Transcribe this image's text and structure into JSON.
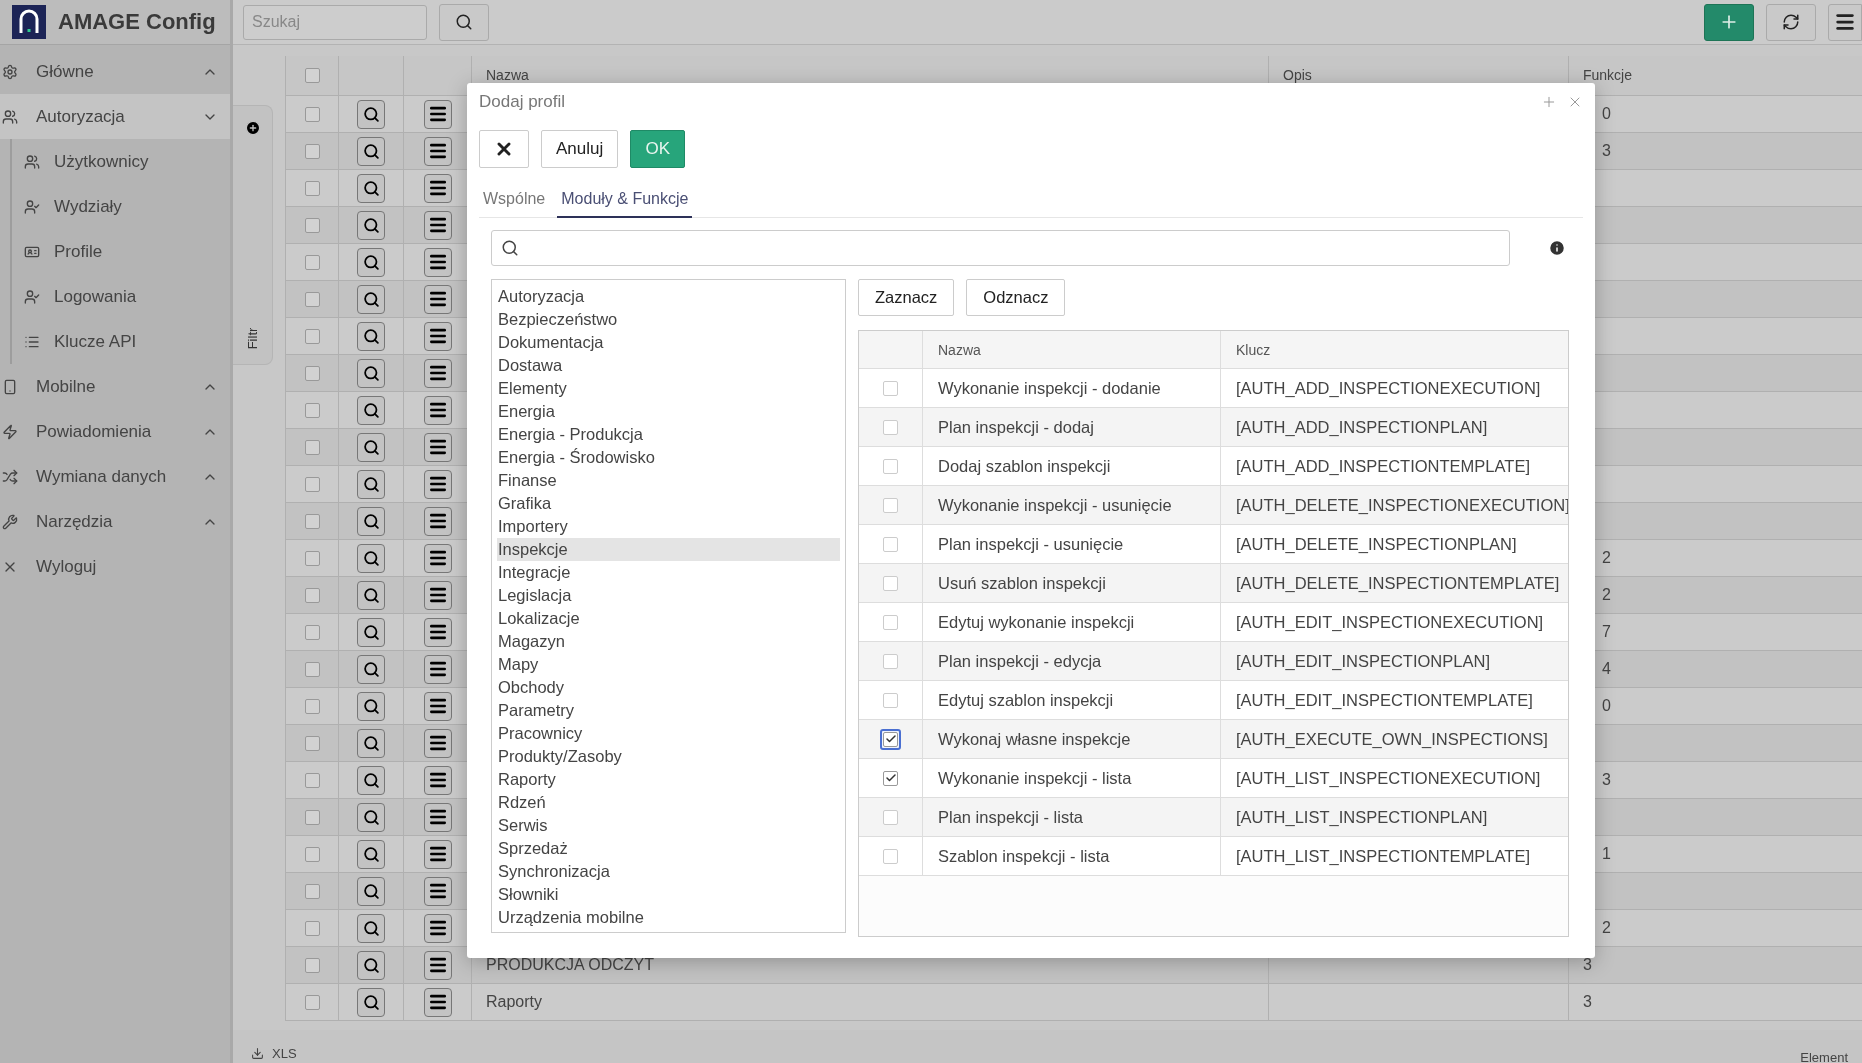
{
  "app": {
    "title": "AMAGE Config"
  },
  "topbar": {
    "search_placeholder": "Szukaj"
  },
  "sidebar": {
    "items": [
      {
        "label": "Główne",
        "kind": "group",
        "expanded": false,
        "selected": false
      },
      {
        "label": "Autoryzacja",
        "kind": "group",
        "expanded": true,
        "selected": true,
        "children": [
          {
            "label": "Użytkownicy"
          },
          {
            "label": "Wydziały"
          },
          {
            "label": "Profile"
          },
          {
            "label": "Logowania"
          },
          {
            "label": "Klucze API"
          }
        ]
      },
      {
        "label": "Mobilne",
        "kind": "group",
        "expanded": false,
        "selected": false
      },
      {
        "label": "Powiadomienia",
        "kind": "group",
        "expanded": false,
        "selected": false
      },
      {
        "label": "Wymiana danych",
        "kind": "group",
        "expanded": false,
        "selected": false
      },
      {
        "label": "Narzędzia",
        "kind": "group",
        "expanded": false,
        "selected": false
      },
      {
        "label": "Wyloguj",
        "kind": "link",
        "selected": false
      }
    ]
  },
  "filter_panel": {
    "label": "Filtr"
  },
  "table": {
    "select_all_checked": false,
    "columns": [
      "Nazwa",
      "Opis",
      "Funkcje"
    ],
    "rows": [
      {
        "checked": false,
        "funkcje": "0"
      },
      {
        "checked": false,
        "funkcje": "3"
      },
      {
        "checked": false
      },
      {
        "checked": false
      },
      {
        "checked": false
      },
      {
        "checked": false
      },
      {
        "checked": false
      },
      {
        "checked": false
      },
      {
        "checked": false
      },
      {
        "checked": false
      },
      {
        "checked": false
      },
      {
        "checked": false
      },
      {
        "checked": false,
        "funkcje": "2"
      },
      {
        "checked": false,
        "funkcje": "2"
      },
      {
        "checked": false,
        "funkcje": "7"
      },
      {
        "checked": false,
        "funkcje": "4"
      },
      {
        "checked": false,
        "funkcje": "0"
      },
      {
        "checked": false
      },
      {
        "checked": false,
        "funkcje": "3"
      },
      {
        "checked": false
      },
      {
        "checked": false,
        "funkcje": "1"
      },
      {
        "checked": false
      },
      {
        "checked": false,
        "funkcje": "2"
      },
      {
        "checked": false,
        "nazwa": "PRODUKCJA ODCZYT",
        "funkcje": "3"
      },
      {
        "checked": false,
        "nazwa": "Raporty",
        "funkcje": "3"
      }
    ]
  },
  "footer": {
    "export": "XLS",
    "count": "Element"
  },
  "dialog": {
    "title": "Dodaj profil",
    "buttons": [
      {
        "kind": "close"
      },
      {
        "kind": "plain",
        "label": "Anuluj"
      },
      {
        "kind": "primary",
        "label": "OK"
      }
    ],
    "tabs": [
      {
        "label": "Wspólne",
        "selected": false
      },
      {
        "label": "Moduły & Funkcje",
        "selected": true
      }
    ],
    "modules": [
      {
        "label": "Autoryzacja",
        "selected": false
      },
      {
        "label": "Bezpieczeństwo",
        "selected": false
      },
      {
        "label": "Dokumentacja",
        "selected": false
      },
      {
        "label": "Dostawa",
        "selected": false
      },
      {
        "label": "Elementy",
        "selected": false
      },
      {
        "label": "Energia",
        "selected": false
      },
      {
        "label": "Energia - Produkcja",
        "selected": false
      },
      {
        "label": "Energia - Środowisko",
        "selected": false
      },
      {
        "label": "Finanse",
        "selected": false
      },
      {
        "label": "Grafika",
        "selected": false
      },
      {
        "label": "Importery",
        "selected": false
      },
      {
        "label": "Inspekcje",
        "selected": true
      },
      {
        "label": "Integracje",
        "selected": false
      },
      {
        "label": "Legislacja",
        "selected": false
      },
      {
        "label": "Lokalizacje",
        "selected": false
      },
      {
        "label": "Magazyn",
        "selected": false
      },
      {
        "label": "Mapy",
        "selected": false
      },
      {
        "label": "Obchody",
        "selected": false
      },
      {
        "label": "Parametry",
        "selected": false
      },
      {
        "label": "Pracownicy",
        "selected": false
      },
      {
        "label": "Produkty/Zasoby",
        "selected": false
      },
      {
        "label": "Raporty",
        "selected": false
      },
      {
        "label": "Rdzeń",
        "selected": false
      },
      {
        "label": "Serwis",
        "selected": false
      },
      {
        "label": "Sprzedaż",
        "selected": false
      },
      {
        "label": "Synchronizacja",
        "selected": false
      },
      {
        "label": "Słowniki",
        "selected": false
      },
      {
        "label": "Urządzenia mobilne",
        "selected": false
      }
    ],
    "actions": [
      "Zaznacz",
      "Odznacz"
    ],
    "functions": {
      "columns": [
        "Nazwa",
        "Klucz"
      ],
      "rows": [
        {
          "name": "Wykonanie inspekcji - dodanie",
          "key": "[AUTH_ADD_INSPECTIONEXECUTION]",
          "checked": false,
          "focused": false
        },
        {
          "name": "Plan inspekcji - dodaj",
          "key": "[AUTH_ADD_INSPECTIONPLAN]",
          "checked": false,
          "focused": false
        },
        {
          "name": "Dodaj szablon inspekcji",
          "key": "[AUTH_ADD_INSPECTIONTEMPLATE]",
          "checked": false,
          "focused": false
        },
        {
          "name": "Wykonanie inspekcji - usunięcie",
          "key": "[AUTH_DELETE_INSPECTIONEXECUTION]",
          "checked": false,
          "focused": false
        },
        {
          "name": "Plan inspekcji - usunięcie",
          "key": "[AUTH_DELETE_INSPECTIONPLAN]",
          "checked": false,
          "focused": false
        },
        {
          "name": "Usuń szablon inspekcji",
          "key": "[AUTH_DELETE_INSPECTIONTEMPLATE]",
          "checked": false,
          "focused": false
        },
        {
          "name": "Edytuj wykonanie inspekcji",
          "key": "[AUTH_EDIT_INSPECTIONEXECUTION]",
          "checked": false,
          "focused": false
        },
        {
          "name": "Plan inspekcji - edycja",
          "key": "[AUTH_EDIT_INSPECTIONPLAN]",
          "checked": false,
          "focused": false
        },
        {
          "name": "Edytuj szablon inspekcji",
          "key": "[AUTH_EDIT_INSPECTIONTEMPLATE]",
          "checked": false,
          "focused": false
        },
        {
          "name": "Wykonaj własne inspekcje",
          "key": "[AUTH_EXECUTE_OWN_INSPECTIONS]",
          "checked": true,
          "focused": true
        },
        {
          "name": "Wykonanie inspekcji - lista",
          "key": "[AUTH_LIST_INSPECTIONEXECUTION]",
          "checked": true,
          "focused": false
        },
        {
          "name": "Plan inspekcji - lista",
          "key": "[AUTH_LIST_INSPECTIONPLAN]",
          "checked": false,
          "focused": false
        },
        {
          "name": "Szablon inspekcji - lista",
          "key": "[AUTH_LIST_INSPECTIONTEMPLATE]",
          "checked": false,
          "focused": false
        }
      ]
    }
  }
}
